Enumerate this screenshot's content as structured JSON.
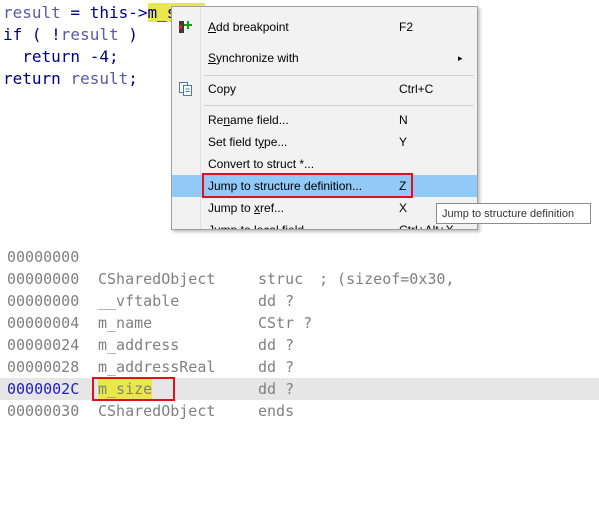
{
  "pseudocode": {
    "line1": {
      "var": "result",
      "op": " = ",
      "kw": "this",
      "arrow": "->",
      "field_hl": "m_size",
      "tail": ";"
    },
    "line2": {
      "kw": "if",
      "pre": " ( !",
      "var": "result",
      "post": " )"
    },
    "line3": {
      "text": "  return -4;"
    },
    "line4": {
      "kw": "return ",
      "var": "result",
      "tail": ";"
    }
  },
  "context_menu": {
    "items": [
      {
        "label_pre": "",
        "label_u": "A",
        "label_post": "dd breakpoint",
        "shortcut": "F2",
        "icon": "breakpoint-icon"
      },
      {
        "label_pre": "",
        "label_u": "S",
        "label_post": "ynchronize with",
        "shortcut": "",
        "submenu": "▸"
      },
      {
        "label_pre": "",
        "label_u": "",
        "label_post": "Copy",
        "shortcut": "Ctrl+C",
        "icon": "copy-icon"
      },
      {
        "label_pre": "Re",
        "label_u": "n",
        "label_post": "ame field...",
        "shortcut": "N"
      },
      {
        "label_pre": "Set field t",
        "label_u": "y",
        "label_post": "pe...",
        "shortcut": "Y"
      },
      {
        "label_pre": "Convert to struct *...",
        "label_u": "",
        "label_post": "",
        "shortcut": ""
      },
      {
        "label_pre": "Jump to structure definition...",
        "label_u": "",
        "label_post": "",
        "shortcut": "Z"
      },
      {
        "label_pre": "Jump to ",
        "label_u": "x",
        "label_post": "ref...",
        "shortcut": "X"
      },
      {
        "label_pre": "Jump to local field...",
        "label_u": "",
        "label_post": "",
        "shortcut": "Ctrl+Alt+X"
      }
    ]
  },
  "tooltip": "Jump to structure definition",
  "structure": {
    "rows": [
      {
        "addr": "00000000",
        "name": "",
        "type": "",
        "comment": ""
      },
      {
        "addr": "00000000",
        "name": "CSharedObject",
        "type": "struc",
        "comment": "; (sizeof=0x30,"
      },
      {
        "addr": "00000000",
        "name": "__vftable",
        "type": "dd ?",
        "comment": ""
      },
      {
        "addr": "00000004",
        "name": "m_name",
        "type": "CStr ?",
        "comment": ""
      },
      {
        "addr": "00000024",
        "name": "m_address",
        "type": "dd ?",
        "comment": ""
      },
      {
        "addr": "00000028",
        "name": "m_addressReal",
        "type": "dd ?",
        "comment": ""
      },
      {
        "addr": "0000002C",
        "name": "m_size",
        "type": "dd ?",
        "comment": ""
      },
      {
        "addr": "00000030",
        "name": "CSharedObject",
        "type": "ends",
        "comment": ""
      }
    ]
  },
  "colors": {
    "highlight": "#e8e84a",
    "menu_hover": "#91c9f7",
    "annotation_red": "#e0101e"
  }
}
